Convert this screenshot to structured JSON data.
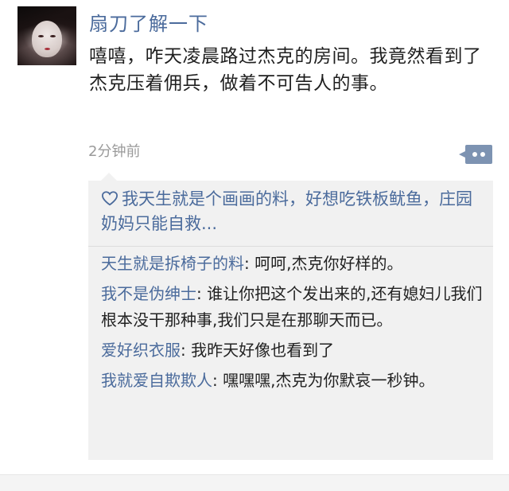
{
  "post": {
    "username": "扇刀了解一下",
    "content": "嘻嘻，咋天凌晨路过杰克的房间。我竟然看到了杰克压着佣兵，做着不可告人的事。",
    "timestamp": "2分钟前"
  },
  "likes": {
    "text": "我天生就是个画画的料，好想吃铁板鱿鱼，庄园奶妈只能自救..."
  },
  "comments": [
    {
      "author": "天生就是拆椅子的料",
      "text": "呵呵,杰克你好样的。"
    },
    {
      "author": "我不是伪绅士",
      "text": "谁让你把这个发出来的,还有媳妇儿我们根本没干那种事,我们只是在那聊天而已。"
    },
    {
      "author": "爱好织衣服",
      "text": "我昨天好像也看到了"
    },
    {
      "author": "我就爱自欺欺人",
      "text": "嘿嘿嘿,杰克为你默哀一秒钟。"
    }
  ],
  "icons": {
    "like": "heart-outline-icon",
    "more": "more-dots-icon"
  },
  "colors": {
    "name_link": "#4b6b9c",
    "more_button": "#7d93b2",
    "panel_bg": "#f1f1f1"
  }
}
